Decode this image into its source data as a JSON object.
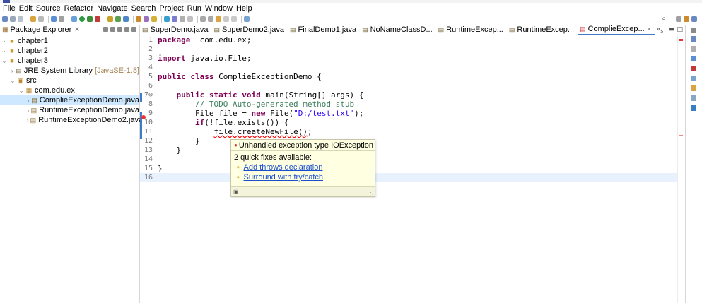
{
  "menu": [
    "File",
    "Edit",
    "Source",
    "Refactor",
    "Navigate",
    "Search",
    "Project",
    "Run",
    "Window",
    "Help"
  ],
  "toolbar": {
    "search_glyph": "⌕"
  },
  "explorer": {
    "title": "Package Explorer",
    "close": "×",
    "tree": [
      {
        "arrow": "›",
        "icon": "folder",
        "label": "chapter1",
        "extra": ""
      },
      {
        "arrow": "›",
        "icon": "folder",
        "label": "chapter2",
        "extra": ""
      },
      {
        "arrow": "⌄",
        "icon": "folder",
        "label": "chapter3",
        "extra": ""
      },
      {
        "arrow": "›",
        "icon": "library",
        "label": "JRE System Library",
        "extra": "[JavaSE-1.8]"
      },
      {
        "arrow": "⌄",
        "icon": "src",
        "label": "src",
        "extra": ""
      },
      {
        "arrow": "⌄",
        "icon": "package",
        "label": "com.edu.ex",
        "extra": ""
      },
      {
        "arrow": "›",
        "icon": "java",
        "label": "ComplieExceptionDemo.java",
        "extra": ""
      },
      {
        "arrow": "›",
        "icon": "java",
        "label": "RuntimeExceptionDemo.java",
        "extra": ""
      },
      {
        "arrow": "›",
        "icon": "java",
        "label": "RuntimeExceptionDemo2.java",
        "extra": ""
      }
    ]
  },
  "tabs": [
    {
      "label": "SuperDemo.java",
      "active": false
    },
    {
      "label": "SuperDemo2.java",
      "active": false
    },
    {
      "label": "FinalDemo1.java",
      "active": false
    },
    {
      "label": "NoNameClassD...",
      "active": false
    },
    {
      "label": "RuntimeExcep...",
      "active": false
    },
    {
      "label": "RuntimeExcep...",
      "active": false
    },
    {
      "label": "ComplieExcep...",
      "active": true
    }
  ],
  "tab_overflow": "»",
  "tab_overflow_count": "5",
  "code_lines": [
    {
      "n": "1",
      "code": [
        [
          "kw",
          "package"
        ],
        [
          "",
          "  com.edu.ex;"
        ]
      ]
    },
    {
      "n": "2",
      "code": []
    },
    {
      "n": "3",
      "code": [
        [
          "kw",
          "import"
        ],
        [
          "",
          " java.io.File;"
        ]
      ]
    },
    {
      "n": "4",
      "code": []
    },
    {
      "n": "5",
      "code": [
        [
          "kw",
          "public class"
        ],
        [
          "",
          " ComplieExceptionDemo {"
        ]
      ]
    },
    {
      "n": "6",
      "code": []
    },
    {
      "n": "7⊖",
      "code": [
        [
          "",
          "    "
        ],
        [
          "kw",
          "public static void"
        ],
        [
          "",
          " main(String[] args) {"
        ]
      ]
    },
    {
      "n": "8",
      "code": [
        [
          "",
          "        "
        ],
        [
          "cm",
          "// TODO Auto-generated method stub"
        ]
      ]
    },
    {
      "n": "9",
      "code": [
        [
          "",
          "        File file = "
        ],
        [
          "kw",
          "new"
        ],
        [
          "",
          " File("
        ],
        [
          "st",
          "\"D:/test.txt\""
        ],
        [
          "",
          ");"
        ]
      ]
    },
    {
      "n": "10",
      "code": [
        [
          "",
          "        "
        ],
        [
          "kw",
          "if"
        ],
        [
          "",
          "(!file.exists()) {"
        ]
      ]
    },
    {
      "n": "11",
      "code": [
        [
          "",
          "            "
        ],
        [
          "err",
          "file.createNewFile()"
        ],
        [
          "",
          ";"
        ]
      ]
    },
    {
      "n": "12",
      "code": [
        [
          "",
          "        }"
        ]
      ]
    },
    {
      "n": "13",
      "code": [
        [
          "",
          "    }"
        ]
      ]
    },
    {
      "n": "14",
      "code": []
    },
    {
      "n": "15",
      "code": [
        [
          "",
          "}"
        ]
      ]
    },
    {
      "n": "16",
      "code": []
    }
  ],
  "quickfix": {
    "message": "Unhandled exception type IOException",
    "count": "2 quick fixes available:",
    "fixes": [
      "Add throws declaration",
      "Surround with try/catch"
    ]
  }
}
